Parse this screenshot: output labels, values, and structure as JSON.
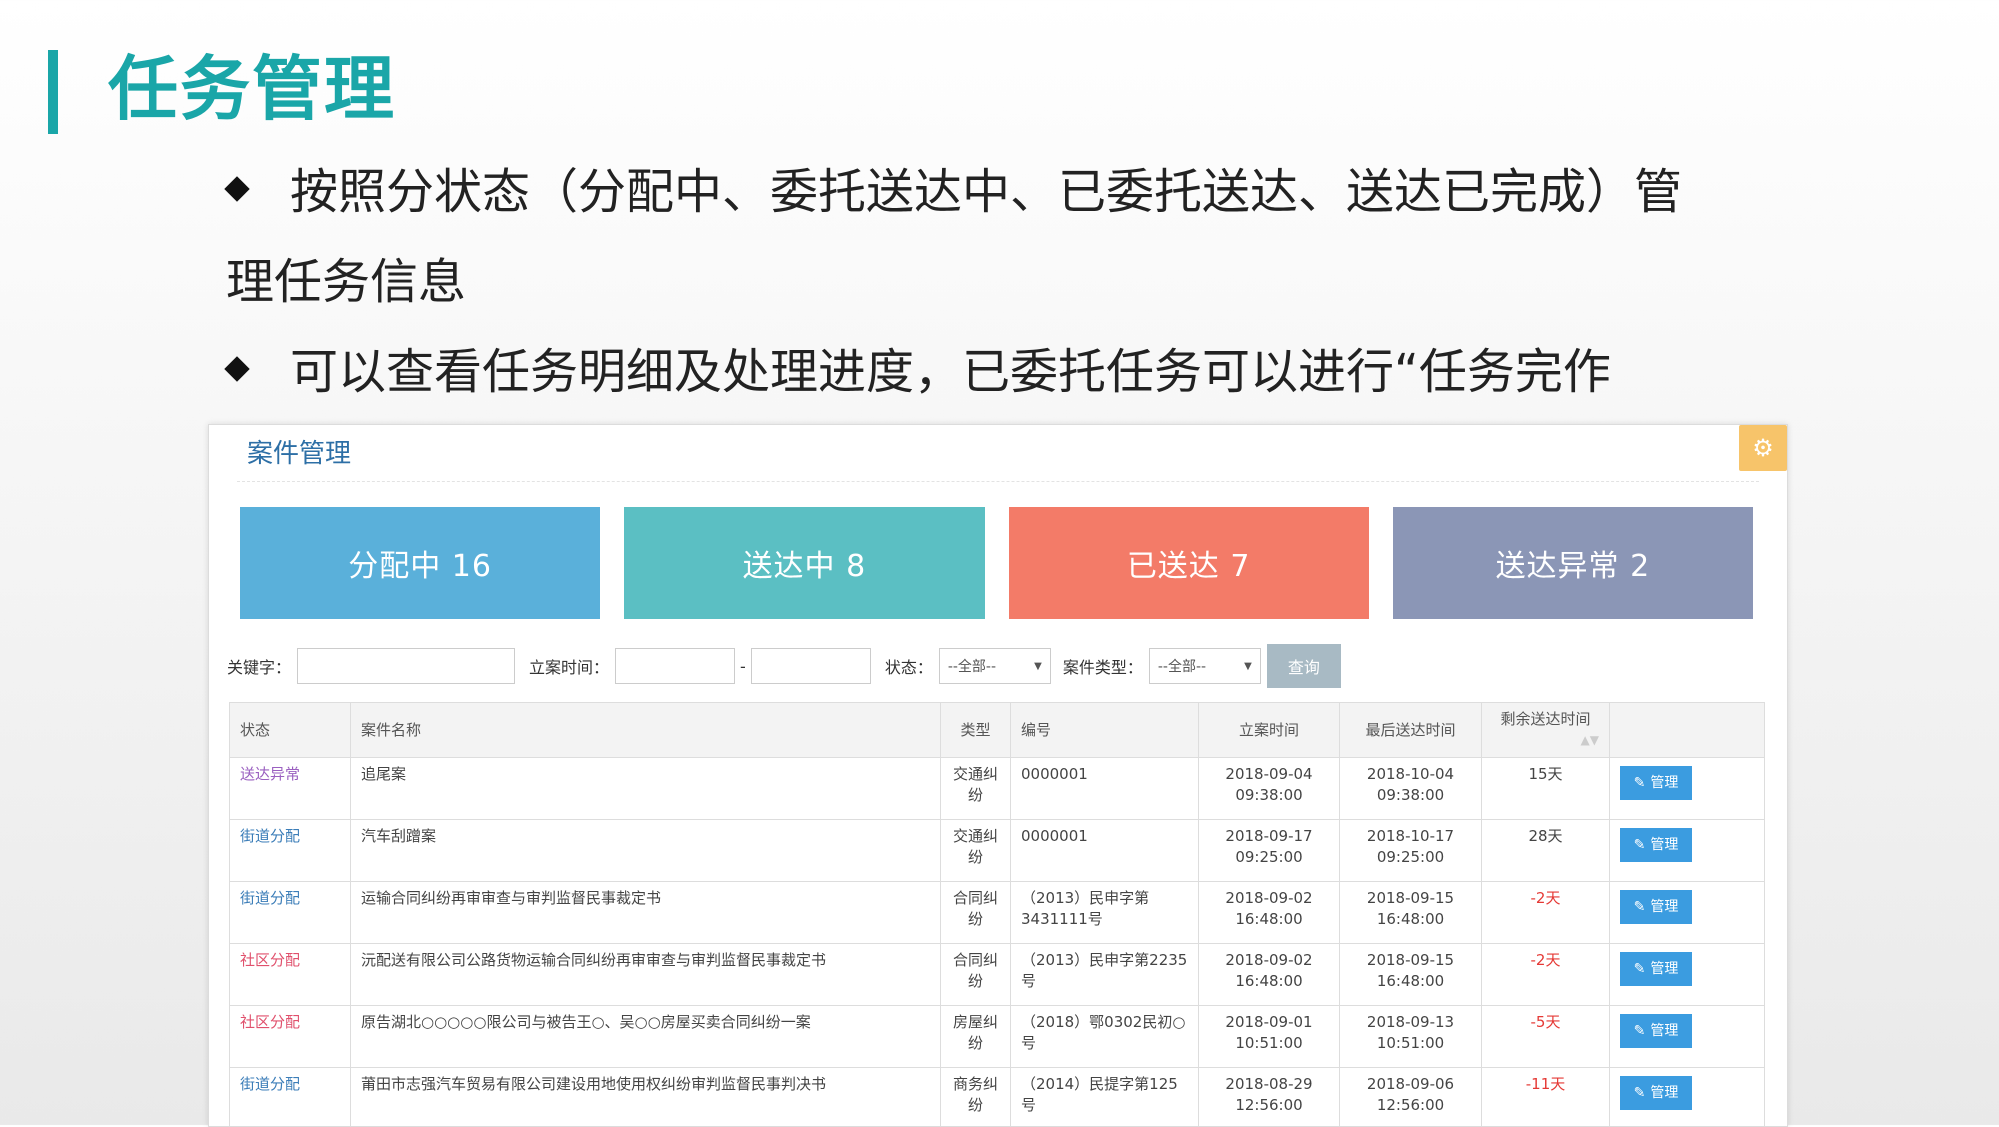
{
  "slide": {
    "title": "任务管理",
    "bullet1_line1": "按照分状态（分配中、委托送达中、已委托送达、送达已完成）管",
    "bullet1_line2": "理任务信息",
    "bullet2": "可以查看任务明细及处理进度，已委托任务可以进行“任务完作"
  },
  "panel": {
    "title": "案件管理",
    "gear_icon": "gear-icon"
  },
  "cards": [
    {
      "label": "分配中 16",
      "color": "#5ab0da"
    },
    {
      "label": "送达中 8",
      "color": "#5bbfc3"
    },
    {
      "label": "已送达 7",
      "color": "#f37b68"
    },
    {
      "label": "送达异常 2",
      "color": "#8b96b6"
    }
  ],
  "filters": {
    "keyword_label": "关键字：",
    "keyword_value": "",
    "date_label": "立案时间：",
    "date_sep": "-",
    "date_from": "",
    "date_to": "",
    "status_label": "状态：",
    "status_value": "--全部--",
    "type_label": "案件类型：",
    "type_value": "--全部--",
    "query_label": "查询"
  },
  "table": {
    "headers": {
      "status": "状态",
      "name": "案件名称",
      "type": "类型",
      "number": "编号",
      "filed": "立案时间",
      "last": "最后送达时间",
      "remain": "剩余送达时间",
      "action": ""
    },
    "manage_label": "管理",
    "rows": [
      {
        "status": "送达异常",
        "status_color": "purple",
        "name": "追尾案",
        "type": "交通纠纷",
        "number": "0000001",
        "filed": "2018-09-04 09:38:00",
        "last": "2018-10-04 09:38:00",
        "remain": "15天",
        "negative": false
      },
      {
        "status": "街道分配",
        "status_color": "blue",
        "name": "汽车刮蹭案",
        "type": "交通纠纷",
        "number": "0000001",
        "filed": "2018-09-17 09:25:00",
        "last": "2018-10-17 09:25:00",
        "remain": "28天",
        "negative": false
      },
      {
        "status": "街道分配",
        "status_color": "blue",
        "name": "运输合同纠纷再审审查与审判监督民事裁定书",
        "type": "合同纠纷",
        "number": "（2013）民申字第3431111号",
        "filed": "2018-09-02 16:48:00",
        "last": "2018-09-15 16:48:00",
        "remain": "-2天",
        "negative": true
      },
      {
        "status": "社区分配",
        "status_color": "red",
        "name": "沅配送有限公司公路货物运输合同纠纷再审审查与审判监督民事裁定书",
        "type": "合同纠纷",
        "number": "（2013）民申字第2235号",
        "filed": "2018-09-02 16:48:00",
        "last": "2018-09-15 16:48:00",
        "remain": "-2天",
        "negative": true
      },
      {
        "status": "社区分配",
        "status_color": "red",
        "name": "原告湖北○○○○○限公司与被告王○、吴○○房屋买卖合同纠纷一案",
        "type": "房屋纠纷",
        "number": "（2018）鄂0302民初○号",
        "filed": "2018-09-01 10:51:00",
        "last": "2018-09-13 10:51:00",
        "remain": "-5天",
        "negative": true
      },
      {
        "status": "街道分配",
        "status_color": "blue",
        "name": "莆田市志强汽车贸易有限公司建设用地使用权纠纷审判监督民事判决书",
        "type": "商务纠纷",
        "number": "（2014）民提字第125号",
        "filed": "2018-08-29 12:56:00",
        "last": "2018-09-06 12:56:00",
        "remain": "-11天",
        "negative": true
      }
    ]
  }
}
